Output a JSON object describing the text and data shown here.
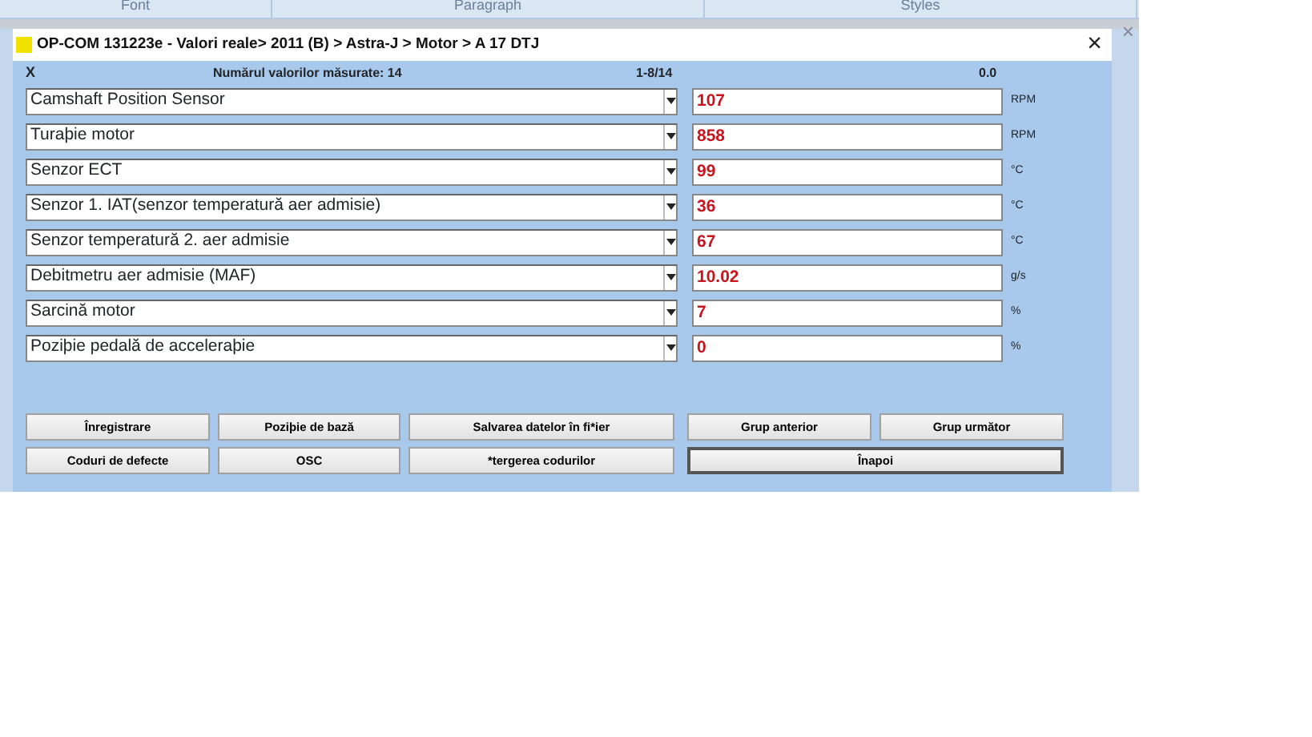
{
  "ribbon": {
    "groups": [
      "Font",
      "Paragraph",
      "Styles"
    ]
  },
  "window": {
    "title": "OP-COM 131223e - Valori reale> 2011 (B) > Astra-J > Motor > A 17 DTJ",
    "close": "×",
    "outer_close": "×"
  },
  "header": {
    "mark": "X",
    "count": "Numărul valorilor măsurate: 14",
    "range": "1-8/14",
    "time": "0.0"
  },
  "values": [
    {
      "name": "Camshaft Position Sensor",
      "value": "107",
      "unit": "RPM"
    },
    {
      "name": "Turaþie motor",
      "value": "858",
      "unit": "RPM"
    },
    {
      "name": "Senzor ECT",
      "value": "99",
      "unit": "°C"
    },
    {
      "name": "Senzor 1.  IAT(senzor temperatură aer admisie)",
      "value": "36",
      "unit": "°C"
    },
    {
      "name": "Senzor temperatură 2.  aer admisie",
      "value": "67",
      "unit": "°C"
    },
    {
      "name": "Debitmetru aer admisie (MAF)",
      "value": "10.02",
      "unit": "g/s"
    },
    {
      "name": "Sarcină motor",
      "value": "7",
      "unit": "%"
    },
    {
      "name": "Poziþie pedală de acceleraþie",
      "value": "0",
      "unit": "%"
    }
  ],
  "buttons": [
    [
      {
        "label": "Înregistrare",
        "focused": false
      },
      {
        "label": "Poziþie de bază",
        "focused": false
      },
      {
        "label": "Salvarea datelor în fi*ier",
        "focused": false
      },
      {
        "label": "Grup anterior",
        "focused": false
      },
      {
        "label": "Grup următor",
        "focused": false
      }
    ],
    [
      {
        "label": "Coduri de defecte",
        "focused": false
      },
      {
        "label": "OSC",
        "focused": false
      },
      {
        "label": "*tergerea codurilor",
        "focused": false
      },
      {
        "label": "Înapoi",
        "focused": true
      }
    ]
  ]
}
